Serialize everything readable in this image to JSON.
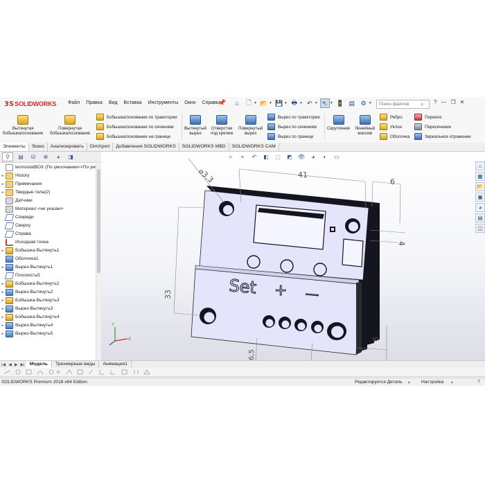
{
  "app": {
    "logo_ds": "3S",
    "logo_name": "SOLIDWORKS",
    "menu": [
      "Файл",
      "Правка",
      "Вид",
      "Вставка",
      "Инструменты",
      "Окно",
      "Справка"
    ],
    "search_placeholder": "Поиск файлов",
    "tb_icons": [
      "home-icon",
      "new-icon",
      "open-icon",
      "save-icon",
      "print-icon",
      "undo-icon",
      "select-icon",
      "rebuild-icon",
      "options-icon"
    ]
  },
  "ribbon": {
    "extrude_boss": [
      "Вытянутая",
      "бобышка/основание"
    ],
    "revolve_boss": [
      "Повернутая",
      "бобышка/основание"
    ],
    "boss_sweep": "Бобышка/основание по траектории",
    "boss_loft": "Бобышка/основание по сечениям",
    "boss_boundary": "Бобышка/основание на границе",
    "extruded_cut": [
      "Вытянутый",
      "вырез"
    ],
    "hole_wizard": [
      "Отверстие",
      "под крепеж"
    ],
    "revolved_cut": [
      "Повернутый",
      "вырез"
    ],
    "swept_cut": "Вырез по траектории",
    "lofted_cut": "Вырез по сечениям",
    "boundary_cut": "Вырез по границе",
    "fillet": "Скругление",
    "linear_pattern": [
      "Линейный",
      "массив"
    ],
    "rib": "Ребро",
    "draft": "Уклон",
    "shell": "Оболочка",
    "move": "Перенос",
    "intersect": "Пересечение",
    "mirror": "Зеркальное отражение"
  },
  "command_tabs": [
    "Элементы",
    "Эскиз",
    "Анализировать",
    "DimXpert",
    "Добавления SOLIDWORKS",
    "SOLIDWORKS MBD",
    "SOLIDWORKS CAM"
  ],
  "feature_tree": [
    {
      "label": "termostatBOX  (По умолчанию<<По ум",
      "icon": "ic-doc",
      "arrow": ""
    },
    {
      "label": "History",
      "icon": "ic-folder",
      "arrow": "▸"
    },
    {
      "label": "Примечания",
      "icon": "ic-folder",
      "arrow": "▸"
    },
    {
      "label": "Твердые тела(2)",
      "icon": "ic-folder",
      "arrow": "▸"
    },
    {
      "label": "Датчики",
      "icon": "ic-gray",
      "arrow": ""
    },
    {
      "label": "Материал <не указан>",
      "icon": "ic-gray",
      "arrow": ""
    },
    {
      "label": "Спереди",
      "icon": "ic-plane",
      "arrow": ""
    },
    {
      "label": "Сверху",
      "icon": "ic-plane",
      "arrow": ""
    },
    {
      "label": "Справа",
      "icon": "ic-plane",
      "arrow": ""
    },
    {
      "label": "Исходная точка",
      "icon": "ic-origin",
      "arrow": ""
    },
    {
      "label": "Бобышка-Вытянуть1",
      "icon": "ic-feat",
      "arrow": "▸"
    },
    {
      "label": "Оболочка1",
      "icon": "ic-cut",
      "arrow": ""
    },
    {
      "label": "Вырез-Вытянуть1",
      "icon": "ic-cut",
      "arrow": "▸"
    },
    {
      "label": "Плоскость5",
      "icon": "ic-plane",
      "arrow": ""
    },
    {
      "label": "Бобышка-Вытянуть2",
      "icon": "ic-feat",
      "arrow": "▸"
    },
    {
      "label": "Вырез-Вытянуть2",
      "icon": "ic-cut",
      "arrow": "▸"
    },
    {
      "label": "Бобышка-Вытянуть3",
      "icon": "ic-feat",
      "arrow": "▸"
    },
    {
      "label": "Вырез-Вытянуть3",
      "icon": "ic-cut",
      "arrow": "▸"
    },
    {
      "label": "Бобышка-Вытянуть4",
      "icon": "ic-feat",
      "arrow": "▸"
    },
    {
      "label": "Вырез-Вытянуть4",
      "icon": "ic-cut",
      "arrow": "▸"
    },
    {
      "label": "Вырез-Вытянуть5",
      "icon": "ic-cut",
      "arrow": "▸"
    }
  ],
  "model": {
    "embossed_text": "Set",
    "plus_text": "+",
    "minus_text": "—",
    "dim_diameter": "⌀3,3",
    "dim_41": "41",
    "dim_6_top": "6",
    "dim_4": "4",
    "dim_33": "33",
    "dim_6_right": "6",
    "dim_6_5": "6,5",
    "colors": {
      "body": "#e4e5fb",
      "edge": "#15151f",
      "dim": "#888888"
    }
  },
  "bottom_tabs": [
    "Модель",
    "Трехмерные виды",
    "Анимация1"
  ],
  "status": {
    "edition": "SOLIDWORKS Premium 2018 x64 Edition",
    "editing": "Редактируется Деталь",
    "settings": "Настройка"
  }
}
